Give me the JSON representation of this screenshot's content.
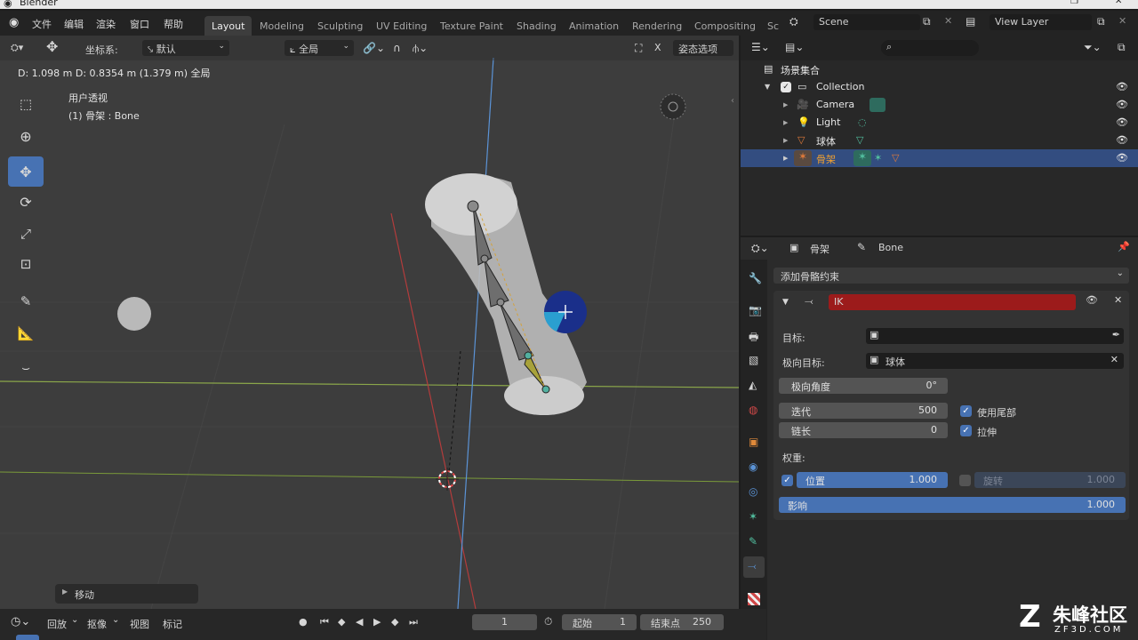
{
  "app": {
    "title": "Blender"
  },
  "menu": {
    "items": [
      "文件",
      "编辑",
      "渲染",
      "窗口",
      "帮助"
    ]
  },
  "workspaces": {
    "tabs": [
      "Layout",
      "Modeling",
      "Sculpting",
      "UV Editing",
      "Texture Paint",
      "Shading",
      "Animation",
      "Rendering",
      "Compositing",
      "Sc"
    ],
    "active": "Layout"
  },
  "scene": {
    "name": "Scene",
    "view_layer": "View Layer"
  },
  "viewport_header": {
    "coord_label": "坐标系:",
    "coord_value": "默认",
    "pivot_value": "全局",
    "pose_options": "姿态选项"
  },
  "viewport": {
    "status": "D: 1.098 m  D: 0.8354 m (1.379 m) 全局",
    "view_name": "用户透视",
    "object_info": "(1) 骨架 : Bone",
    "last_op": "移动"
  },
  "outliner": {
    "root": "场景集合",
    "items": [
      {
        "label": "Collection",
        "icon": "collection-icon",
        "selected": false
      },
      {
        "label": "Camera",
        "icon": "camera-icon",
        "selected": false
      },
      {
        "label": "Light",
        "icon": "light-icon",
        "selected": false
      },
      {
        "label": "球体",
        "icon": "mesh-icon",
        "selected": false
      },
      {
        "label": "骨架",
        "icon": "armature-icon",
        "selected": true
      }
    ]
  },
  "properties": {
    "breadcrumb_object": "骨架",
    "breadcrumb_bone": "Bone",
    "add_constraint": "添加骨骼约束",
    "constraint_name": "IK",
    "target_label": "目标:",
    "target_value": "",
    "pole_label": "极向目标:",
    "pole_value": "球体",
    "pole_angle_label": "极向角度",
    "pole_angle_value": "0°",
    "iterations_label": "迭代",
    "iterations_value": "500",
    "chain_label": "链长",
    "chain_value": "0",
    "use_tail_label": "使用尾部",
    "use_tail": true,
    "stretch_label": "拉伸",
    "stretch": true,
    "weight_label": "权重:",
    "position_label": "位置",
    "position_value": "1.000",
    "position_enabled": true,
    "rotation_label": "旋转",
    "rotation_value": "1.000",
    "rotation_enabled": false,
    "influence_label": "影响",
    "influence_value": "1.000"
  },
  "timeline": {
    "playback": "回放",
    "keying": "抠像",
    "view": "视图",
    "marker": "标记",
    "current_frame": "1",
    "start_label": "起始",
    "start_value": "1",
    "end_label": "结束点",
    "end_value": "250"
  },
  "watermark": {
    "brand": "朱峰社区",
    "url": "ZF3D.COM"
  },
  "colors": {
    "accent": "#4772b3",
    "ik_header": "#9c1b1b",
    "selected_row": "#334d80",
    "viewport_bg": "#3d3d3d"
  }
}
